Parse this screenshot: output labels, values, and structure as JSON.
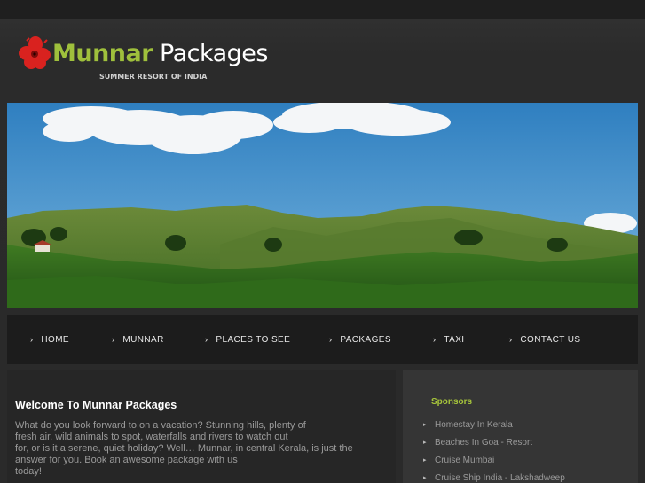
{
  "header": {
    "logo_word1": "Munnar",
    "logo_word2": "Packages",
    "tagline": "SUMMER RESORT OF INDIA",
    "logo_color": "#9fc03c"
  },
  "nav": {
    "items": [
      {
        "label": "HOME"
      },
      {
        "label": "MUNNAR"
      },
      {
        "label": "PLACES TO SEE"
      },
      {
        "label": "PACKAGES"
      },
      {
        "label": "TAXI"
      },
      {
        "label": "CONTACT US"
      }
    ]
  },
  "main": {
    "title": "Welcome To Munnar Packages",
    "paragraph_lines": [
      "What do you look forward to on a vacation? Stunning hills, plenty of",
      "fresh air, wild animals to spot, waterfalls and rivers to watch out",
      "for, or is it a serene, quiet holiday? Well… Munnar, in central Kerala, is just the",
      "answer for you. Book an awesome package with us",
      "today!"
    ]
  },
  "sidebar": {
    "title": "Sponsors",
    "accent": "#a6c43b",
    "items": [
      {
        "label": "Homestay In Kerala"
      },
      {
        "label": "Beaches In Goa - Resort"
      },
      {
        "label": "Cruise Mumbai"
      },
      {
        "label": "Cruise Ship India - Lakshadweep"
      }
    ]
  }
}
